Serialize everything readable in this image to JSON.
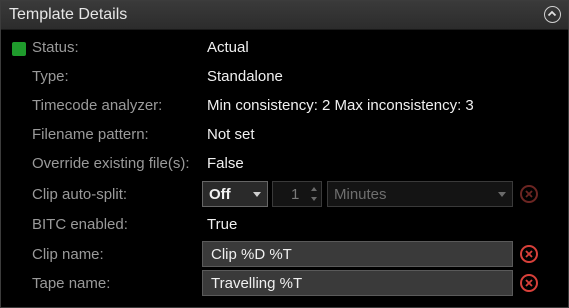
{
  "panel": {
    "title": "Template Details"
  },
  "icons": {
    "collapse": "chevron-up-icon",
    "clear": "clear-x-icon",
    "status": "status-square-icon"
  },
  "colors": {
    "status_ok": "#1f9b2c",
    "clear_accent": "#d8403a"
  },
  "fields": {
    "status": {
      "label": "Status:",
      "value": "Actual"
    },
    "type": {
      "label": "Type:",
      "value": "Standalone"
    },
    "timecode": {
      "label": "Timecode analyzer:",
      "value": "Min consistency: 2 Max inconsistency: 3"
    },
    "filename": {
      "label": "Filename pattern:",
      "value": "Not set"
    },
    "override": {
      "label": "Override existing file(s):",
      "value": "False"
    },
    "autosplit": {
      "label": "Clip auto-split:",
      "mode": "Off",
      "count": "1",
      "unit": "Minutes"
    },
    "bitc": {
      "label": "BITC enabled:",
      "value": "True"
    },
    "clip_name": {
      "label": "Clip name:",
      "value": "Clip %D %T"
    },
    "tape_name": {
      "label": "Tape name:",
      "value": "Travelling %T"
    }
  }
}
